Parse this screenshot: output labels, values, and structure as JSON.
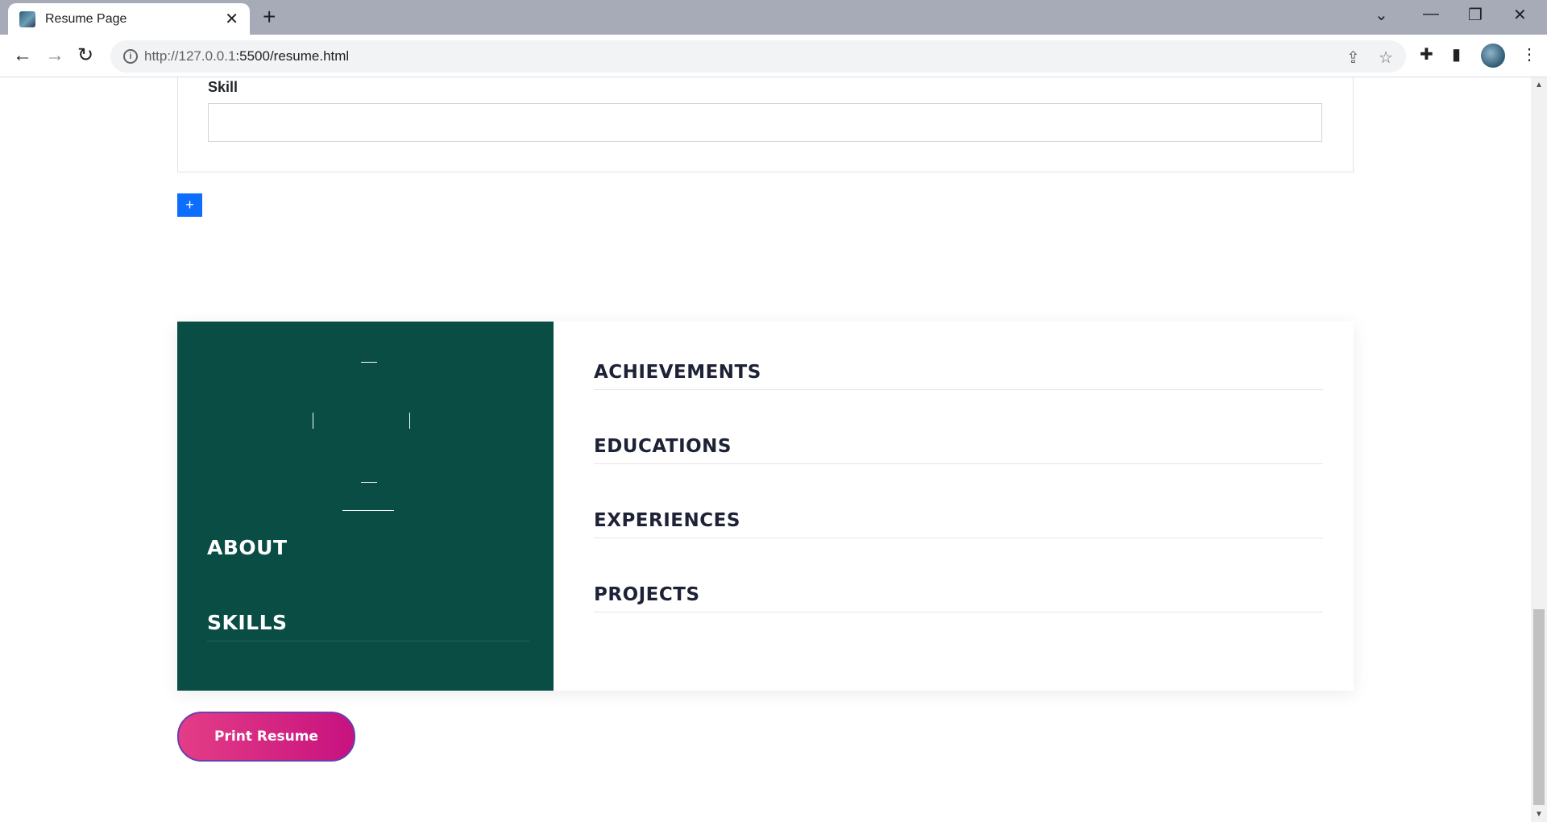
{
  "browser": {
    "tab_title": "Resume Page",
    "url_host": "http://127.0.0.1",
    "url_rest": ":5500/resume.html"
  },
  "form": {
    "skill_label": "Skill",
    "skill_value": "",
    "add_label": "+"
  },
  "preview": {
    "left_sections": [
      "ABOUT",
      "SKILLS"
    ],
    "right_sections": [
      "ACHIEVEMENTS",
      "EDUCATIONS",
      "EXPERIENCES",
      "PROJECTS"
    ]
  },
  "print_button": "Print Resume",
  "colors": {
    "sidebar": "#0a4d45",
    "accent_pink": "#d42a84",
    "add_button": "#0d6efd"
  }
}
